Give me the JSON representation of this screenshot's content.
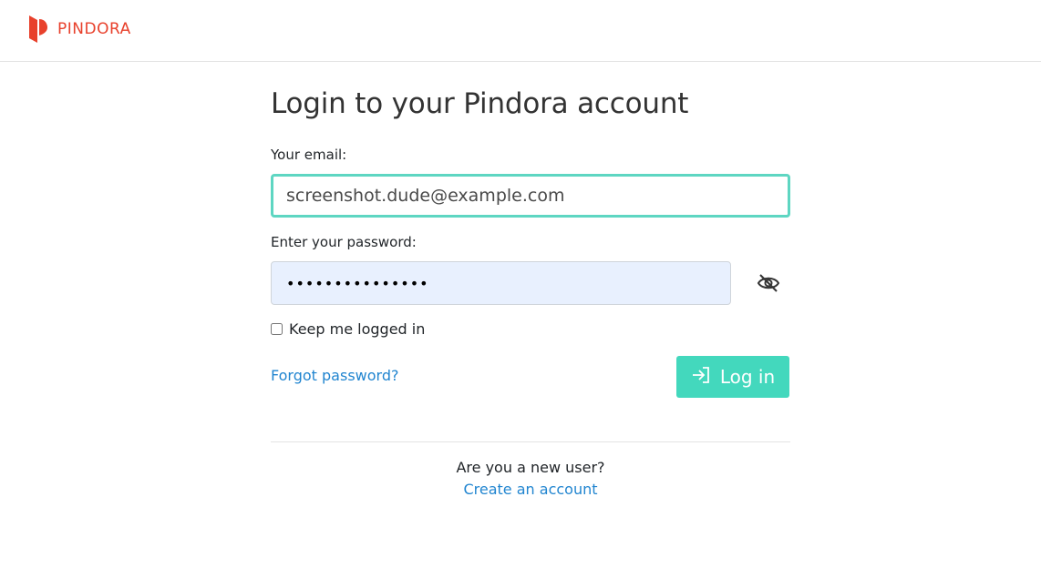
{
  "header": {
    "brand_name": "PINDORA",
    "brand_color": "#e8412c"
  },
  "login": {
    "title": "Login to your Pindora account",
    "email_label": "Your email:",
    "email_value": "screenshot.dude@example.com",
    "password_label": "Enter your password:",
    "password_value": "•••••••••••••••",
    "toggle_icon": "eye-slash-icon",
    "keep_logged_in_label": "Keep me logged in",
    "keep_logged_in_checked": false,
    "forgot_password_label": "Forgot password?",
    "login_button_label": "Log in",
    "login_button_icon": "sign-in-icon",
    "accent_color": "#43d8bd",
    "link_color": "#2185d0"
  },
  "signup": {
    "prompt": "Are you a new user?",
    "create_account_label": "Create an account"
  }
}
